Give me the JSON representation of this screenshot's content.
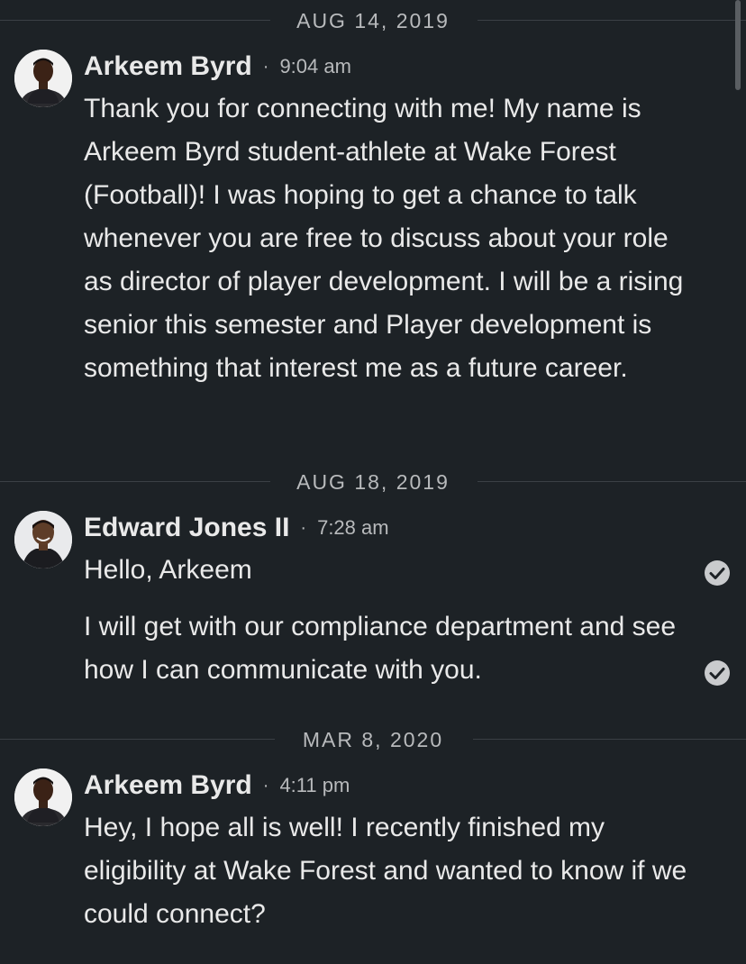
{
  "messages_thread": {
    "groups": [
      {
        "date": "AUG 14, 2019",
        "sender": "Arkeem Byrd",
        "separator": "·",
        "time": "9:04 am",
        "avatar_icon": "profile-photo-arkeem-byrd",
        "messages": [
          "Thank you for connecting with me! My name is Arkeem Byrd student-athlete at Wake Forest (Football)! I was hoping to get a chance to talk whenever you are free to discuss about your role as director of player development. I will be a rising senior this semester and Player development is something that interest me as a future career."
        ]
      },
      {
        "date": "AUG 18, 2019",
        "sender": "Edward Jones II",
        "separator": "·",
        "time": "7:28 am",
        "avatar_icon": "profile-photo-edward-jones",
        "messages": [
          "Hello, Arkeem",
          "I will get with our compliance department and see how I can communicate with you."
        ],
        "read_icon": "check-circle-icon"
      },
      {
        "date": "MAR 8, 2020",
        "sender": "Arkeem Byrd",
        "separator": "·",
        "time": "4:11 pm",
        "avatar_icon": "profile-photo-arkeem-byrd",
        "messages": [
          "Hey, I hope all is well! I recently finished my eligibility at Wake Forest and wanted to know if we could connect?"
        ]
      }
    ]
  },
  "colors": {
    "background": "#1d2226",
    "text_primary": "#e9e9e9",
    "text_secondary": "#b8babc",
    "divider": "#3b4045"
  }
}
